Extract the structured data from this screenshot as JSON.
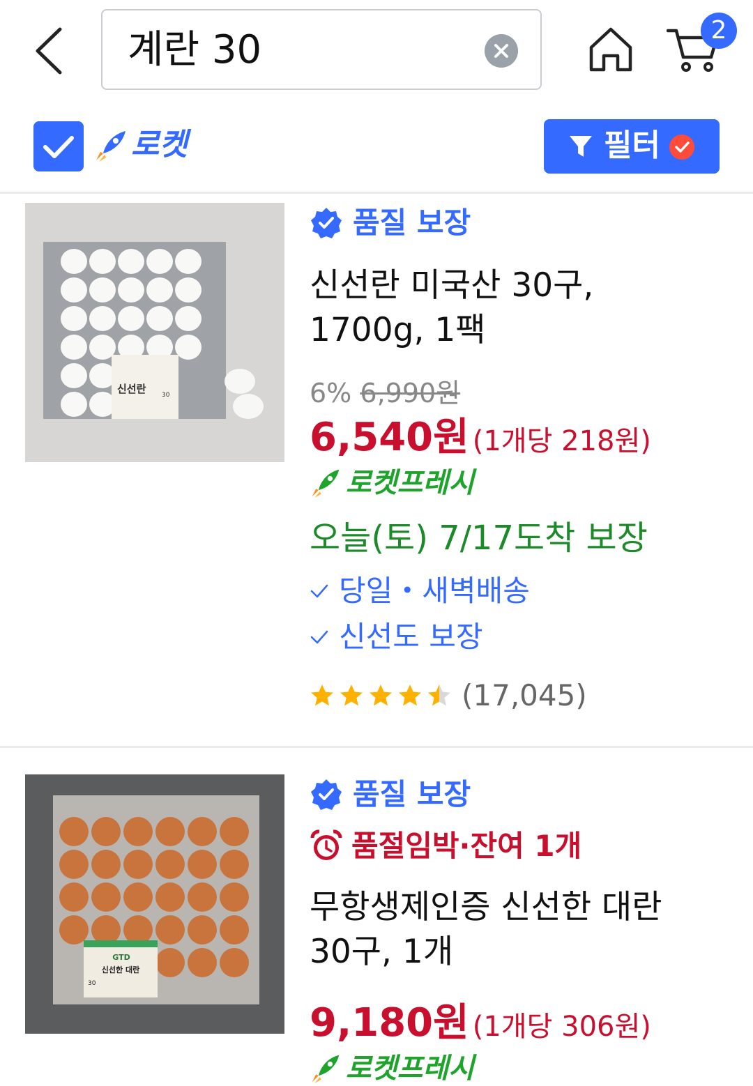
{
  "header": {
    "search_value": "계란 30",
    "cart_count": "2"
  },
  "filter_bar": {
    "rocket_label": "로켓",
    "filter_label": "필터"
  },
  "products": [
    {
      "quality_badge": "품질 보장",
      "title_line1": "신선란 미국산 30구,",
      "title_line2": "1700g, 1팩",
      "discount": "6%",
      "original_price": "6,990원",
      "price": "6,540원",
      "unit_price": "(1개당 218원)",
      "delivery_badge": "로켓프레시",
      "arrival": "오늘(토) 7/17도착 보장",
      "features": [
        "당일・새벽배송",
        "신선도 보장"
      ],
      "rating": 4.5,
      "review_count": "(17,045)",
      "package_label": "신선란",
      "package_count": "30"
    },
    {
      "quality_badge": "품질 보장",
      "stock_warning": "품절임박·잔여 1개",
      "title_line1": "무항생제인증 신선한 대란",
      "title_line2": "30구, 1개",
      "price": "9,180원",
      "unit_price": "(1개당 306원)",
      "delivery_badge": "로켓프레시",
      "package_label": "신선한 대란",
      "package_brand": "GTD",
      "package_count": "30"
    }
  ],
  "colors": {
    "accent": "#346aff",
    "price": "#c8102e",
    "fresh": "#1ea32b",
    "arrival": "#1d8a2a"
  }
}
